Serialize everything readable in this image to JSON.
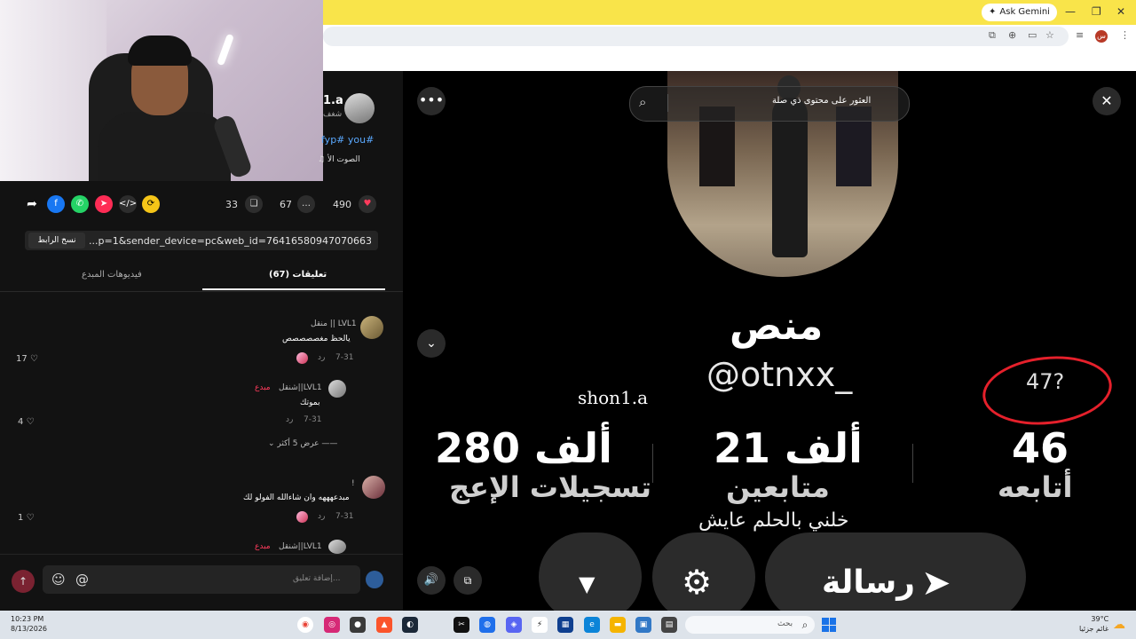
{
  "browser": {
    "ask_gemini_label": "Ask Gemini",
    "profile_initial": "س",
    "colors": {
      "top_bar": "#f9e44a"
    }
  },
  "author": {
    "name": "1.a",
    "subtitle": "شغف",
    "hashtags": "fyp# you#",
    "sound": "♫ الصوت الأ"
  },
  "actions": {
    "likes": "490",
    "comments": "67",
    "saves": "33",
    "like_color": "#ff3b5c"
  },
  "link": {
    "url": "...p=1&sender_device=pc&web_id=7641658094707066385",
    "copy_label": "نسخ الرابط"
  },
  "tabs": {
    "comments_label": "تعليقات (67)",
    "creator_videos_label": "فيديوهات المبدع"
  },
  "comments": [
    {
      "name": "منقل || LVL1",
      "text": "يالحظ مغصصصصص",
      "date": "7-31",
      "reply": "رد",
      "likes": "17"
    },
    {
      "name": "شنقل||LVL1",
      "creator_tag": "مبدع",
      "text": "بموتك",
      "date": "7-31",
      "reply": "رد",
      "likes": "4"
    },
    {
      "name": "!",
      "text": "مبدعهههه وان شاءالله الفولو لك",
      "date": "7-31",
      "reply": "رد",
      "likes": "1"
    },
    {
      "name": "شنقل||LVL1",
      "creator_tag": "مبدع"
    }
  ],
  "view_more_label": "عرض 5 أكثر",
  "comment_input": {
    "placeholder": "إضافة تعليق..."
  },
  "video": {
    "search_placeholder": "العثور على محتوى ذي صلة",
    "profile_name": "منص",
    "handle": "@otnxx_",
    "watermark": "shon1.a",
    "annotation": "47?",
    "stats": [
      {
        "value": "46",
        "label": "أتابعه"
      },
      {
        "value": "21 ألف",
        "label": "متابعين"
      },
      {
        "value": "280 ألف",
        "label": "تسجيلات الإعج"
      }
    ],
    "bio": "خلني بالحلم عايش",
    "message_button": "رسالة"
  },
  "taskbar": {
    "time": "10:23 PM",
    "date": "8/13/2026",
    "search_placeholder": "بحث",
    "temperature": "39°C",
    "weather_text": "غائم جزئيا"
  }
}
